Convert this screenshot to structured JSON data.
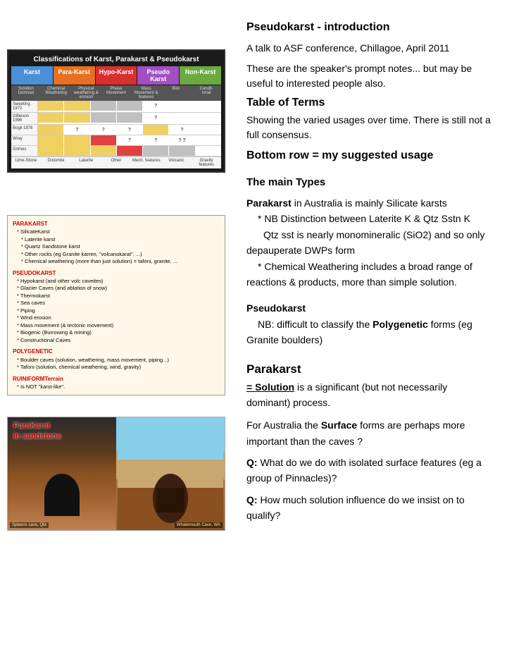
{
  "page": {
    "title": "Pseudokarst - introduction"
  },
  "rightCol": {
    "section1": {
      "title": "Pseudokarst - introduction",
      "subtitle": "A talk to ASF conference, Chillagoe, April 2011",
      "note": "These are the speaker's prompt notes... but may be useful to interested people also.",
      "tableOfTermsHeading": "Table of Terms",
      "tableOfTermsDesc": "Showing the varied usages over time. There is still not a full consensus.",
      "bottomRowNote": "Bottom row = my suggested usage"
    },
    "section2": {
      "mainTypesHeading": "The main Types",
      "parakarstIntro1": "Parakarst",
      "parakarstIntro2": " in Australia is mainly Silicate karsts",
      "parakarstNB1": "* NB Distinction between Laterite K & Qtz Sstn K",
      "parakarstNB2": "Qtz sst is nearly monomineralic (SiO2) and so only depauperate DWPs form",
      "parakarstNB3": "* Chemical Weathering includes a broad range of reactions & products, more than simple solution.",
      "pseudokarstTitle": "Pseudokarst",
      "pseudokarstNB": "NB: difficult to classify the",
      "polygenetic": "Polygenetic",
      "pseudokarstForms": "forms  (eg Granite boulders)"
    },
    "section3": {
      "parakarstTitle": "Parakarst",
      "solutionDesc": "= Solution",
      "solutionDesc2": " is a significant (but not necessarily dominant) process.",
      "surfaceFormsLine": "For Australia the",
      "surfaceBold": "Surface",
      "surfaceFormsLine2": " forms are perhaps more important than the caves ?",
      "q1": "Q:",
      "q1Text": " What do we do with isolated surface features (eg a group of Pinnacles)?",
      "q2": "Q:",
      "q2Text": " How much solution influence do we insist on to qualify?"
    }
  },
  "classTable": {
    "title": "Classifications of Karst, Parakarst & Pseudokarst",
    "headers": [
      "Karst",
      "Para-Karst",
      "Hypo-Karst",
      "Pseudo Karst",
      "Non-Karst"
    ],
    "leftCaption": "Spleens cave, Qld",
    "rightCaption": "Whalemouth Cave, WA"
  },
  "parakarstBox": {
    "parakarstHeading": "PARAKARST",
    "silicateKarst": "* SilicateKarst",
    "lateriteKarst": "* Laterite karst",
    "quartz": "* Quartz Sandstone karst",
    "otherRocks": "* Other rocks (eg Granite karren, \"volcanokarat\",  ...)",
    "chemical": "* Chemical weathering (more than just solution) = tafoni, granite, ...",
    "pseudokarstHeading": "PSEUDOKARST",
    "hypokarst": "* Hypokarst (and other volc caveites)",
    "glacier": "* Glacier Caves (and ablation of snow)",
    "thermo": "* Thermokarst",
    "sea": "* Sea caves",
    "piping": "* Piping",
    "wind": "* Wind erosion",
    "mass": "* Mass movement (& tectonic movement)",
    "biogenic": "* Biogenic (Burrowing & mining)",
    "constructional": "* Constructional Caves",
    "polyHeading": "POLYGENETIC",
    "boulder": "* Boulder caves (solution, weathering, mass movement, piping...)",
    "tafoniPoly": "* Tafoni (solution, chemical weathering, wind, gravity)",
    "ruiniformHeading": "RUINIFORMTerrain",
    "notKarst": "* Is NOT \"karst-like\"."
  },
  "bottomImage": {
    "label1": "ParaKarst",
    "label2": "in sandstone",
    "leftCaption": "Spleens cave, Qld",
    "rightCaption": "Whalemouth Cave, WA"
  }
}
